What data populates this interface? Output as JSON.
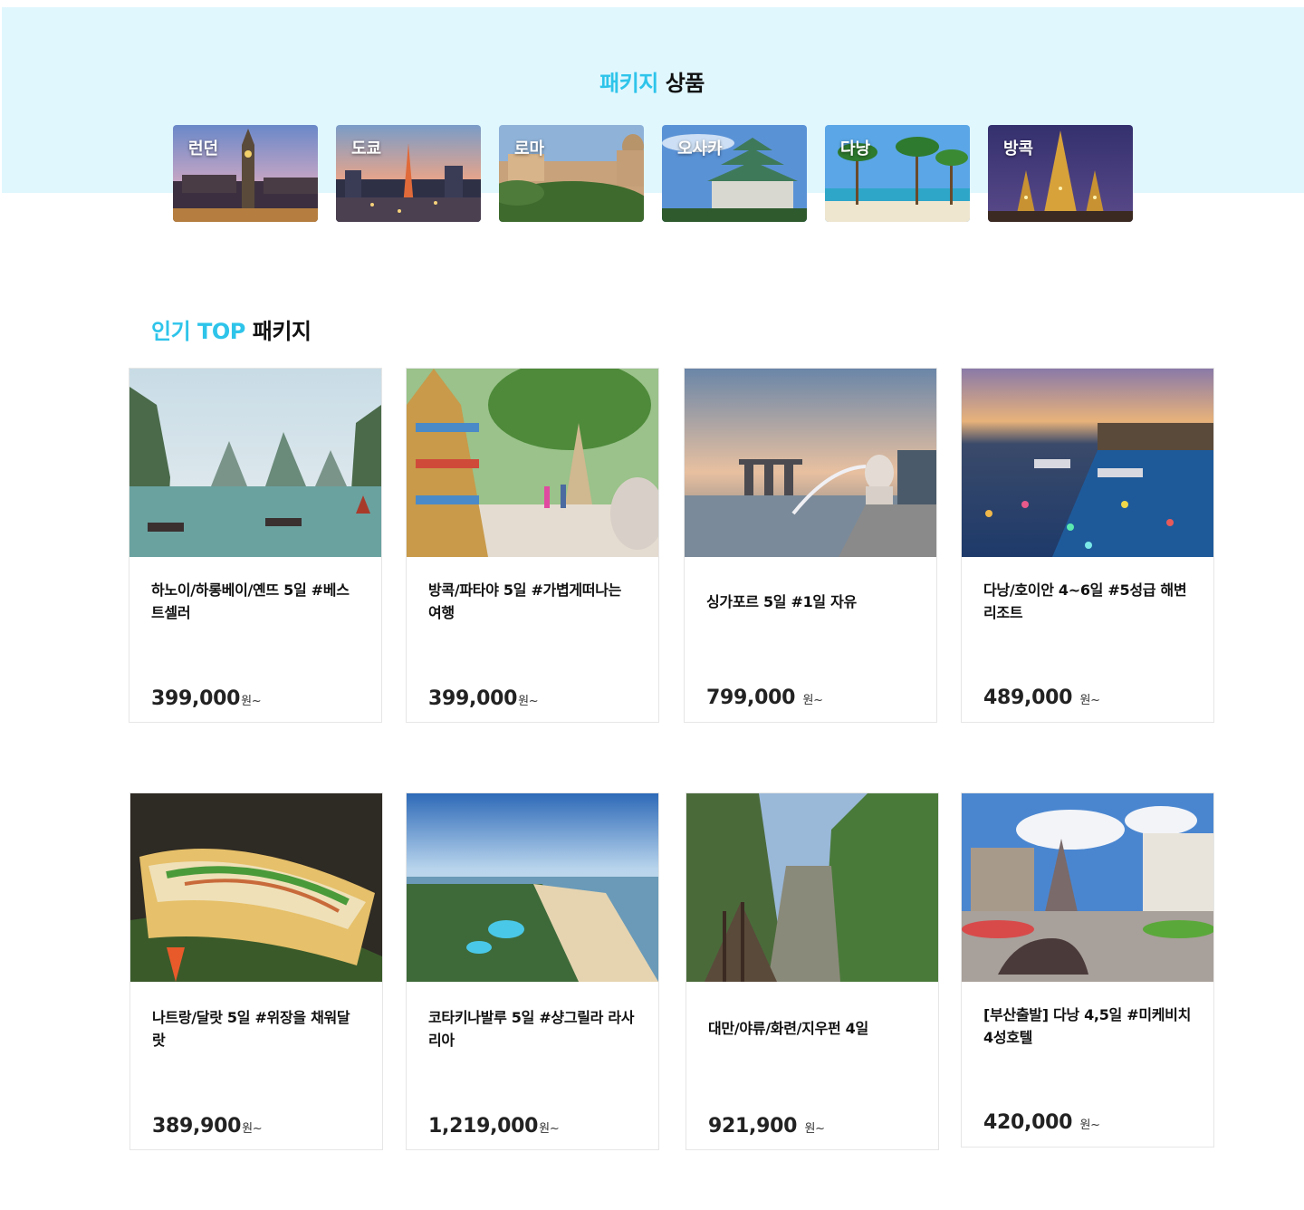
{
  "package_section": {
    "title_accent": "패키지",
    "title_rest": "상품",
    "cities": [
      {
        "label": "런던"
      },
      {
        "label": "도쿄"
      },
      {
        "label": "로마"
      },
      {
        "label": "오사카"
      },
      {
        "label": "다낭"
      },
      {
        "label": "방콕"
      }
    ]
  },
  "top_section": {
    "title_accent": "인기 TOP",
    "title_rest": "패키지",
    "cards": [
      {
        "title": "하노이/하롱베이/옌뜨 5일 #베스트셀러",
        "price": "399,000",
        "unit": "원~"
      },
      {
        "title": "방콕/파타야 5일 #가볍게떠나는 여행",
        "price": "399,000",
        "unit": "원~"
      },
      {
        "title": "싱가포르 5일 #1일 자유",
        "price": "799,000",
        "unit": "원~"
      },
      {
        "title": "다낭/호이안 4~6일 #5성급 해변 리조트",
        "price": "489,000",
        "unit": "원~"
      },
      {
        "title": "나트랑/달랏 5일 #위장을 채워달랏",
        "price": "389,900",
        "unit": "원~"
      },
      {
        "title": "코타키나발루 5일 #샹그릴라 라사리아",
        "price": "1,219,000",
        "unit": "원~"
      },
      {
        "title": "대만/야류/화련/지우펀 4일",
        "price": "921,900",
        "unit": "원~"
      },
      {
        "title": "[부산출발] 다낭 4,5일 #미케비치 4성호텔",
        "price": "420,000",
        "unit": "원~"
      }
    ]
  }
}
